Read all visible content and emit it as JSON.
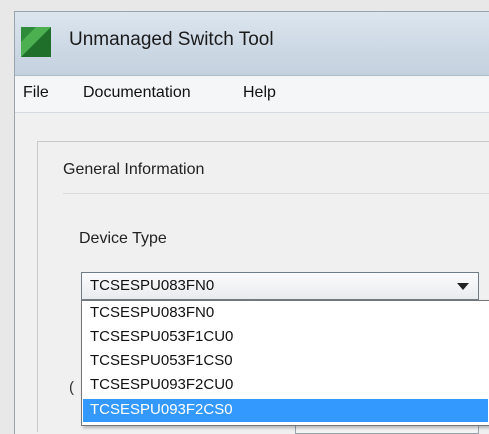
{
  "window": {
    "title": "Unmanaged Switch Tool",
    "icon": "green-leaf-app-icon"
  },
  "menu": {
    "items": [
      "File",
      "Documentation",
      "Help"
    ]
  },
  "general_information": {
    "group_title": "General Information",
    "device_type": {
      "label": "Device Type",
      "selected_value": "TCSESPU083FN0",
      "options": [
        "TCSESPU083FN0",
        "TCSESPU053F1CU0",
        "TCSESPU053F1CS0",
        "TCSESPU093F2CU0",
        "TCSESPU093F2CS0"
      ],
      "highlighted_option": "TCSESPU093F2CS0"
    }
  },
  "colors": {
    "highlight": "#3399ff",
    "app_icon_green": "#2e8b3a"
  }
}
